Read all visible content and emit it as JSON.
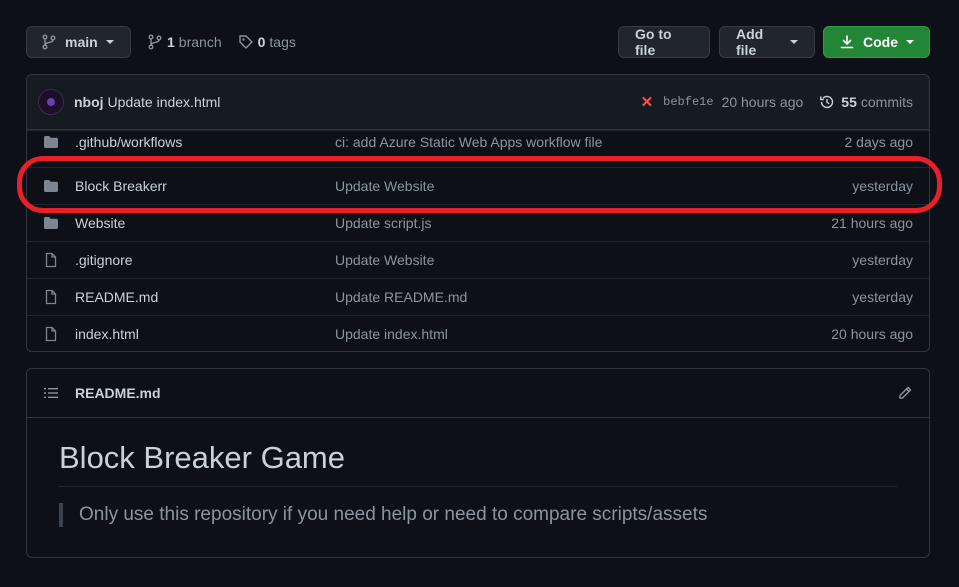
{
  "toolbar": {
    "branch_label": "main",
    "branch_count": "1",
    "branch_word": "branch",
    "tag_count": "0",
    "tag_word": "tags",
    "goto_label": "Go to file",
    "addfile_label": "Add file",
    "code_label": "Code"
  },
  "commit": {
    "author": "nboj",
    "message": "Update index.html",
    "sha": "bebfe1e",
    "time": "20 hours ago",
    "count": "55",
    "count_word": "commits"
  },
  "files": [
    {
      "name": ".github/workflows",
      "message": "ci: add Azure Static Web Apps workflow file",
      "date": "2 days ago",
      "type": "folder"
    },
    {
      "name": "Block Breakerr",
      "message": "Update Website",
      "date": "yesterday",
      "type": "folder"
    },
    {
      "name": "Website",
      "message": "Update script.js",
      "date": "21 hours ago",
      "type": "folder"
    },
    {
      "name": ".gitignore",
      "message": "Update Website",
      "date": "yesterday",
      "type": "file"
    },
    {
      "name": "README.md",
      "message": "Update README.md",
      "date": "yesterday",
      "type": "file"
    },
    {
      "name": "index.html",
      "message": "Update index.html",
      "date": "20 hours ago",
      "type": "file"
    }
  ],
  "readme": {
    "filename": "README.md",
    "heading": "Block Breaker Game",
    "quote": "Only use this repository if you need help or need to compare scripts/assets"
  },
  "colors": {
    "background": "#0d1117",
    "code_button": "#238636",
    "highlight": "#e8202a",
    "fail_x": "#f85149"
  }
}
